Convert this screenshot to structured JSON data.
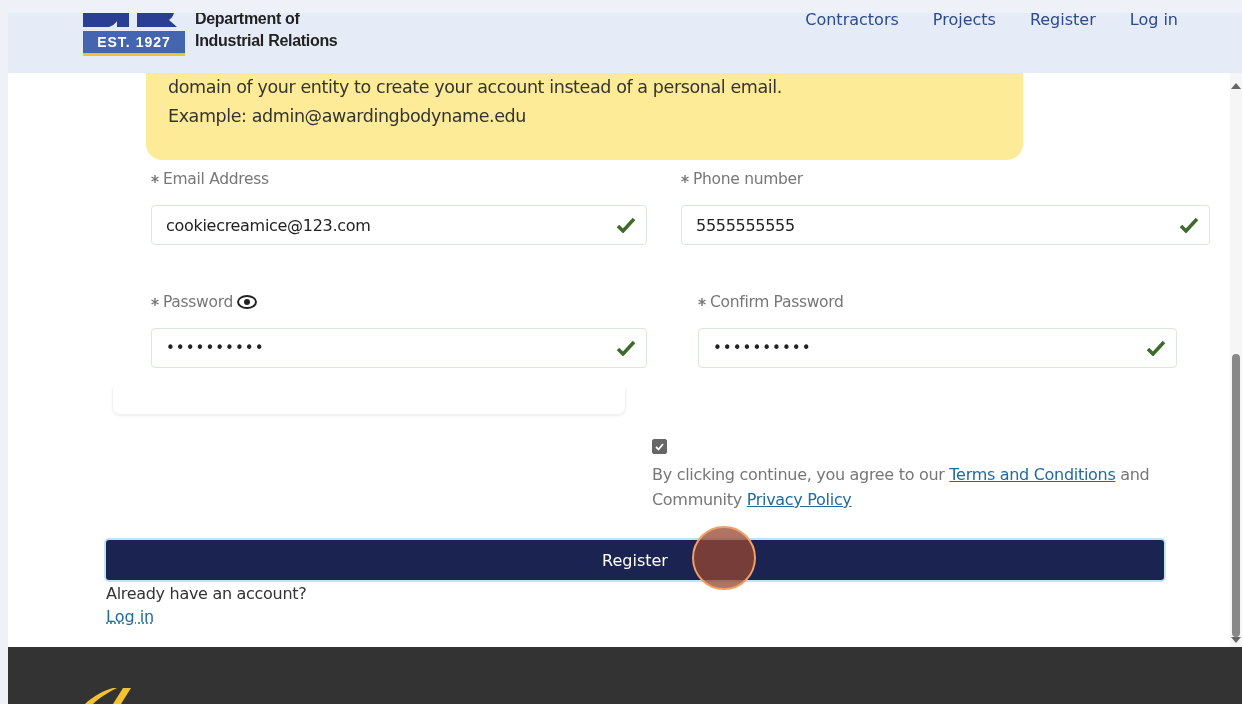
{
  "header": {
    "logo_badge": "EST. 1927",
    "org_name": [
      "Department of",
      "Industrial Relations"
    ],
    "nav": [
      {
        "label": "Contractors"
      },
      {
        "label": "Projects"
      },
      {
        "label": "Register"
      },
      {
        "label": "Log in"
      }
    ]
  },
  "notice": {
    "lines": [
      "domain of your entity to create your account instead of a personal email.",
      "Example: admin@awardingbodyname.edu"
    ]
  },
  "fields": [
    {
      "label": "Email Address",
      "value": "cookiecreamice@123.com",
      "kind": "text",
      "valid": true,
      "show_toggle": false
    },
    {
      "label": "Phone number",
      "value": "5555555555",
      "kind": "text",
      "valid": true,
      "show_toggle": false
    },
    {
      "label": "Password",
      "value": "••••••••••",
      "kind": "password",
      "valid": true,
      "show_toggle": true
    },
    {
      "label": "Confirm Password",
      "value": "••••••••••",
      "kind": "password",
      "valid": true,
      "show_toggle": false
    }
  ],
  "agreement": {
    "checked": true,
    "prefix": "By clicking continue, you agree to our",
    "terms_link": "Terms and Conditions",
    "middle": "and Community",
    "privacy_link": "Privacy Policy"
  },
  "register_button": "Register",
  "login_prompt": "Already have an account?",
  "login_link": "Log in"
}
